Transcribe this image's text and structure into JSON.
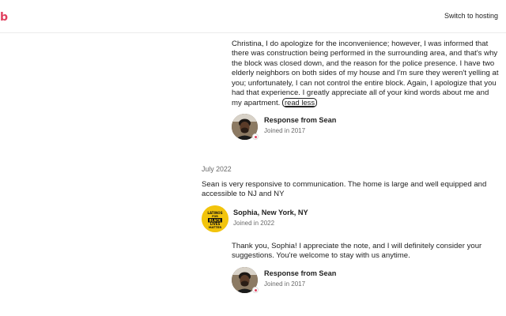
{
  "header": {
    "logo_text": "b",
    "switch_hosting_label": "Switch to hosting"
  },
  "colors": {
    "brand": "#e0405e",
    "text": "#222222",
    "muted": "#6a6a6a",
    "reviewer_avatar_bg": "#f2c40c"
  },
  "host_response_1": {
    "text": "Christina, I do apologize for the inconvenience; however, I was informed that there was construction being performed in the surrounding area, and that's why the block was closed down, and the reason for the police presence. I have two elderly neighbors on both sides of my house and I'm sure they weren't yelling at you; unfortunately, I can not control the entire block. Again, I apologize that you had that experience. I greatly appreciate all of your kind words about me and my apartment.",
    "read_less_label": "read less",
    "title": "Response from Sean",
    "joined": "Joined in 2017",
    "avatar_icon": "host-avatar-icon"
  },
  "review": {
    "date": "July 2022",
    "text": "Sean is very responsive to communication. The home is large and well equipped and accessible to NJ and NY",
    "reviewer_name": "Sophia, New York, NY",
    "reviewer_joined": "Joined in 2022",
    "avatar_lines": [
      "LATINOS",
      "FOR",
      "BLACK",
      "LIVES",
      "MATTER"
    ]
  },
  "host_response_2": {
    "text": "Thank you, Sophia! I appreciate the note, and I will definitely consider your suggestions. You're welcome to stay with us anytime.",
    "title": "Response from Sean",
    "joined": "Joined in 2017"
  }
}
